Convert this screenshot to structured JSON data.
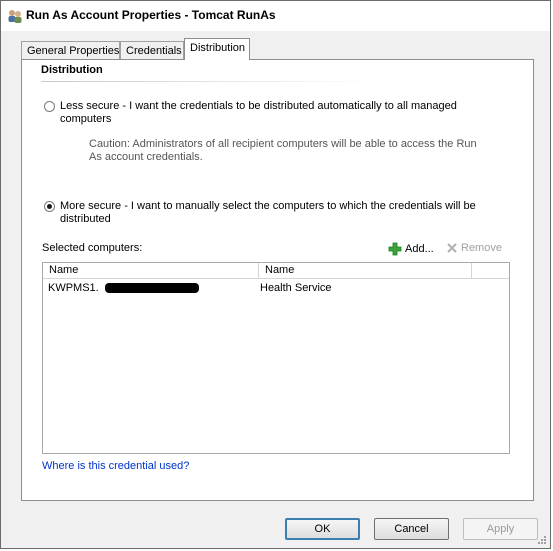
{
  "window": {
    "title": "Run As Account Properties - Tomcat RunAs",
    "icon": "users-icon"
  },
  "tabs": [
    {
      "label": "General Properties",
      "active": false
    },
    {
      "label": "Credentials",
      "active": false
    },
    {
      "label": "Distribution",
      "active": true
    }
  ],
  "distribution": {
    "section_title": "Distribution",
    "less_secure": {
      "label_line1": "Less secure - I want the credentials to be distributed automatically to all managed",
      "label_line2": "computers",
      "checked": false
    },
    "caution_line1": "Caution: Administrators of all recipient computers will be able to access the Run",
    "caution_line2": "As account credentials.",
    "more_secure": {
      "label_line1": "More secure - I want to manually select the computers to which the credentials will be",
      "label_line2": "distributed",
      "checked": true
    },
    "selected_computers_label": "Selected computers:",
    "add_label": "Add...",
    "remove_label": "Remove",
    "columns": [
      "Name",
      "Name"
    ],
    "rows": [
      {
        "computer": "KWPMS1.",
        "service": "Health Service"
      }
    ],
    "link_text": "Where is this credential used?"
  },
  "buttons": {
    "ok": "OK",
    "cancel": "Cancel",
    "apply": "Apply"
  },
  "colors": {
    "link": "#0033cc",
    "add_icon": "#3aa63a",
    "default_button_border": "#3c7fb1"
  }
}
